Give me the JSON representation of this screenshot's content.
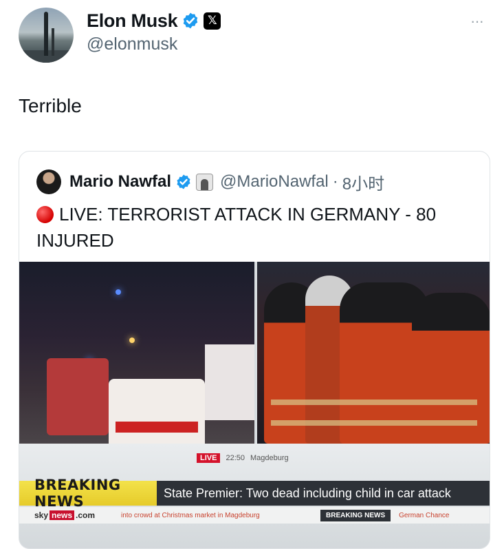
{
  "author": {
    "name": "Elon Musk",
    "handle": "@elonmusk",
    "verified_icon": "verified-badge-icon",
    "affiliate_icon": "x-logo-icon"
  },
  "more_label": "···",
  "tweet_text": "Terrible",
  "quoted": {
    "name": "Mario Nawfal",
    "handle": "@MarioNawfal",
    "separator": "·",
    "time": "8小时",
    "live_icon": "red-circle-icon",
    "text": "LIVE: TERRORIST ATTACK IN GERMANY - 80 INJURED"
  },
  "broadcast": {
    "live_label": "LIVE",
    "time": "22:50",
    "location": "Magdeburg",
    "breaking_label": "BREAKING NEWS",
    "headline": "State Premier: Two dead including child in car attack",
    "channel_prefix": "sky",
    "channel_news": "news",
    "channel_suffix": ".com",
    "ticker_text": "into crowd at Christmas market in Magdeburg",
    "ticker_break": "BREAKING NEWS",
    "ticker_tail": "German Chance"
  },
  "colors": {
    "verified": "#1d9bf0",
    "breaking_yellow": "#f3e24a",
    "live_red": "#d4122b"
  }
}
